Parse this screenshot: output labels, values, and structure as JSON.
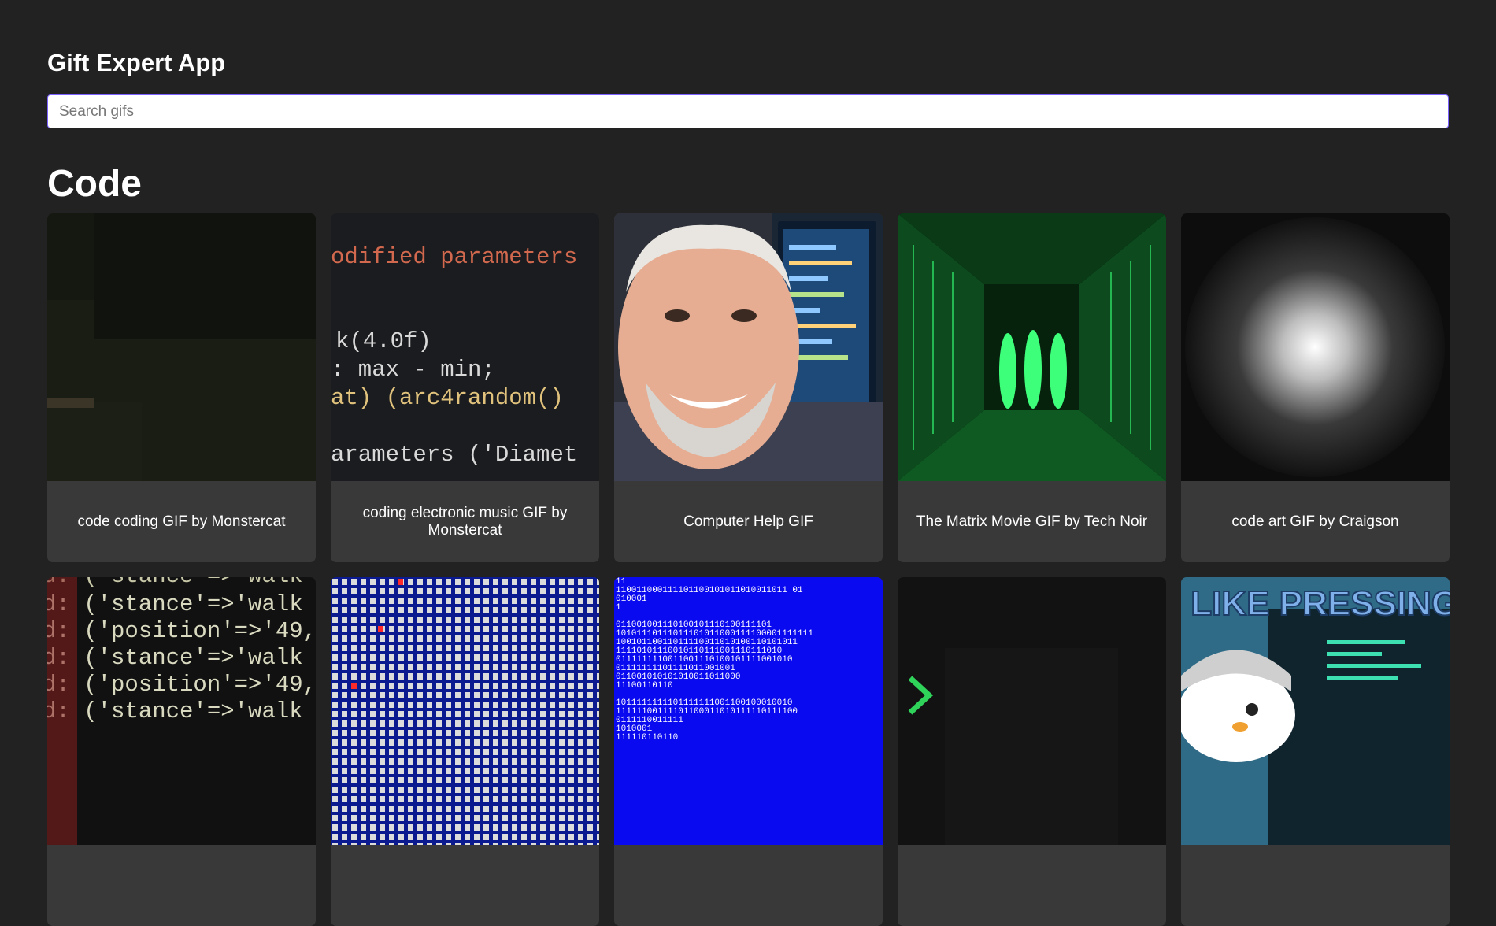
{
  "app": {
    "title": "Gift Expert App"
  },
  "search": {
    "placeholder": "Search gifs",
    "value": ""
  },
  "categories": [
    {
      "name": "Code",
      "gifs": [
        {
          "title": "code coding GIF by Monstercat",
          "image": "dark-desk-scene"
        },
        {
          "title": "coding electronic music GIF by Monstercat",
          "image": "code-closeup"
        },
        {
          "title": "Computer Help GIF",
          "image": "smiling-man-monitor"
        },
        {
          "title": "The Matrix Movie GIF by Tech Noir",
          "image": "matrix-corridor"
        },
        {
          "title": "code art GIF by Craigson",
          "image": "glowing-sphere"
        },
        {
          "title": "",
          "image": "stance-walk-code"
        },
        {
          "title": "",
          "image": "blue-binary-grid"
        },
        {
          "title": "",
          "image": "blue-screen-binary"
        },
        {
          "title": "",
          "image": "terminal-prompt"
        },
        {
          "title": "",
          "image": "i-like-pressing"
        }
      ]
    }
  ],
  "image_text": {
    "code_lines": [
      "odified parameters",
      "k(4.0f)",
      ": max - min;",
      "at) (arc4random()",
      "arameters ('Diamet"
    ],
    "stance_lines": [
      "d: ('stance'=>'walk",
      "d: ('position'=>'49,",
      "d: ('stance'=>'walk",
      "d: ('position'=>'49,",
      "d: ('stance'=>'walk"
    ],
    "blue_lines": [
      "11",
      "110011000111101100101011010011011 01",
      "010001",
      "1",
      "",
      "011001001110100101110100111101",
      "10101110111011101011000111100001111111",
      "10010110011011110011010100110101011",
      "11110101110010110111001110111010",
      "0111111110011001110100101111001010",
      "01111111101111011001001",
      "011001010101010011011000",
      "11100110110",
      "",
      "1011111111101111111001100100010010",
      "11111100111101100011010111110111100",
      "0111110011111",
      "1010001",
      "111110110110"
    ],
    "pressing_caption": "I LIKE PRESSING"
  }
}
